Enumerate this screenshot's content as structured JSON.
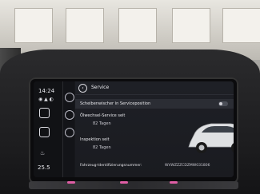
{
  "status_bar": {
    "time": "14:24",
    "temp": "25.5"
  },
  "header": {
    "title": "Service"
  },
  "items": [
    {
      "label": "Scheibenwischer in Serviceposition"
    },
    {
      "label": "Ölwechsel-Service seit",
      "value": "82 Tagen"
    },
    {
      "label": "Inspektion seit",
      "value": "82 Tagen"
    },
    {
      "label": "Fahrzeug-Identifizierungsnummer:",
      "value": "WVWZZZCDZMW031806"
    }
  ]
}
